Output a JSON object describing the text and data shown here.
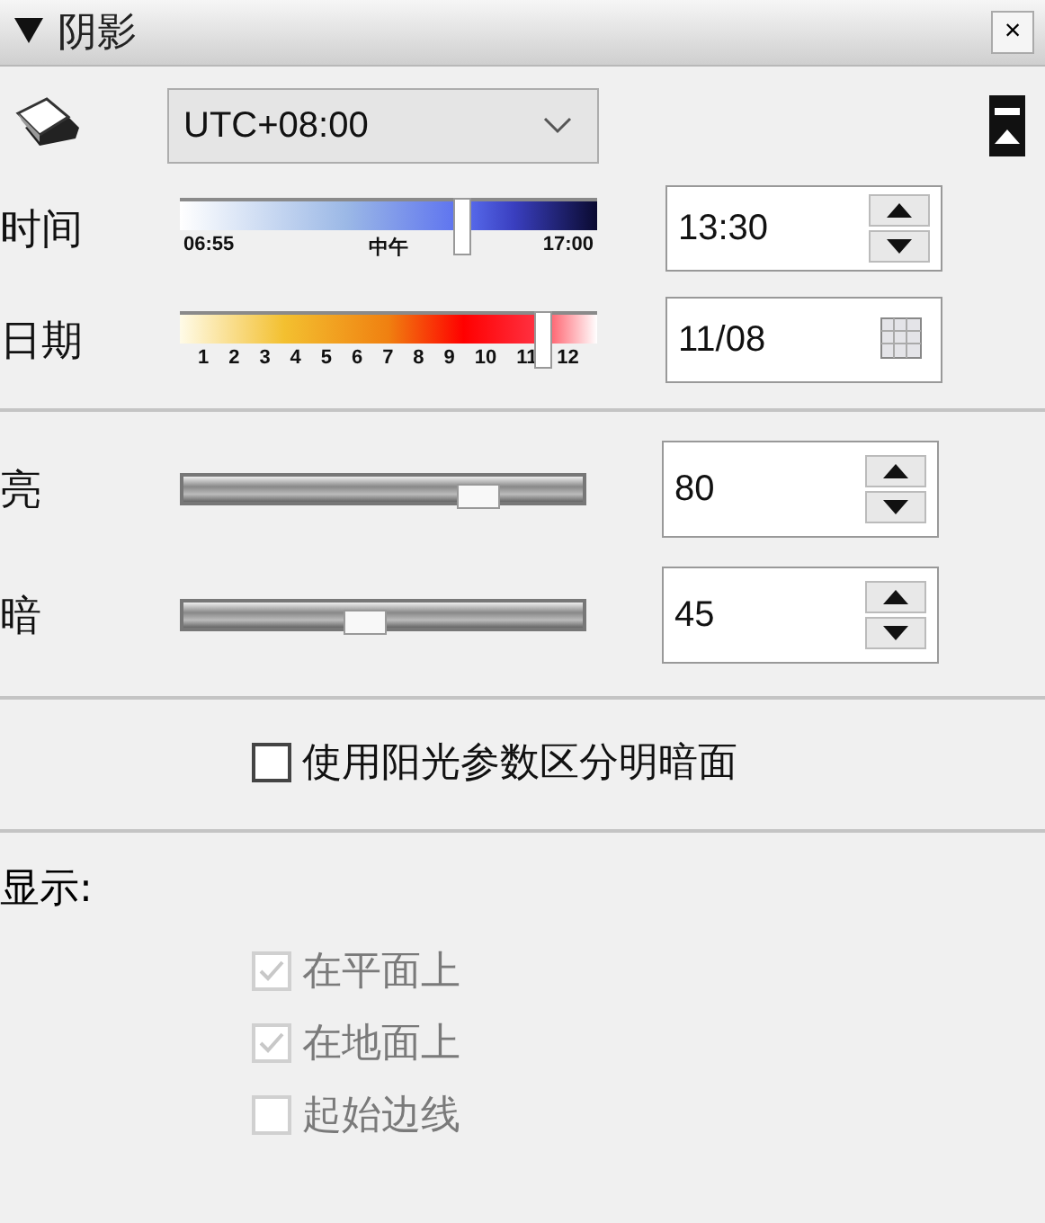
{
  "panel": {
    "title": "阴影",
    "expanded": true,
    "close": "×"
  },
  "timezone": {
    "value": "UTC+08:00"
  },
  "time": {
    "label": "时间",
    "level": 0.68,
    "ticks": [
      "06:55",
      "中午",
      "17:00"
    ],
    "value": "13:30"
  },
  "date": {
    "label": "日期",
    "level": 0.88,
    "ticks": [
      "1",
      "2",
      "3",
      "4",
      "5",
      "6",
      "7",
      "8",
      "9",
      "10",
      "11",
      "12"
    ],
    "value": "11/08"
  },
  "light": [
    {
      "label": "亮",
      "level": 0.77,
      "value": "80"
    },
    {
      "label": "暗",
      "level": 0.45,
      "value": "45"
    }
  ],
  "use_sun": {
    "label": "使用阳光参数区分明暗面",
    "checked": false,
    "disabled": false
  },
  "display": {
    "label": "显示:",
    "options": [
      {
        "label": "在平面上",
        "checked": true,
        "disabled": true
      },
      {
        "label": "在地面上",
        "checked": true,
        "disabled": true
      },
      {
        "label": "起始边线",
        "checked": false,
        "disabled": true
      }
    ]
  }
}
